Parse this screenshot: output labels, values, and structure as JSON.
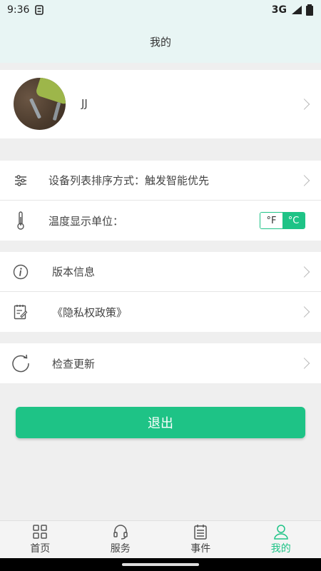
{
  "status": {
    "time": "9:36",
    "network": "3G"
  },
  "header": {
    "title": "我的"
  },
  "profile": {
    "name": "JJ"
  },
  "settings": {
    "sort_label": "设备列表排序方式：触发智能优先",
    "temp_label": "温度显示单位：",
    "temp_options": [
      "°F",
      "°C"
    ],
    "temp_selected": "°C"
  },
  "about": {
    "version_label": "版本信息",
    "privacy_label": "《隐私权政策》"
  },
  "update": {
    "label": "检查更新"
  },
  "logout_label": "退出",
  "tabs": [
    {
      "label": "首页",
      "icon": "grid-icon"
    },
    {
      "label": "服务",
      "icon": "headset-icon"
    },
    {
      "label": "事件",
      "icon": "calendar-icon"
    },
    {
      "label": "我的",
      "icon": "user-icon"
    }
  ],
  "colors": {
    "accent": "#1ec386",
    "header_bg": "#e8f5f4"
  }
}
